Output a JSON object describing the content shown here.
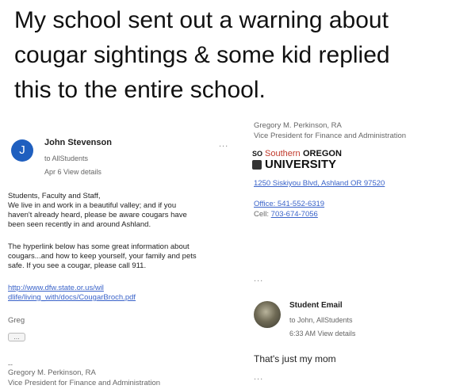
{
  "caption": {
    "line1": "My school sent out a warning about",
    "line2": "cougar sightings & some kid replied",
    "line3": "this to the entire school."
  },
  "left_email": {
    "avatar_letter": "J",
    "sender": "John Stevenson",
    "to": "to AllStudents",
    "date": "Apr 6",
    "view_details": "View details",
    "more": "...",
    "body_lines": [
      "Students, Faculty and Staff,",
      "We live in and work in a beautiful valley; and if you",
      "haven't already heard, please be aware cougars have",
      "been seen recently in and around Ashland."
    ],
    "body2_lines": [
      "The hyperlink below has some great information about",
      "cougars...and how to keep yourself, your family and pets",
      "safe.  If you see a cougar, please call 911."
    ],
    "link_line1": "http://www.dfw.state.or.us/wil",
    "link_line2": "dlife/living_with/docs/CougarBroch.pdf",
    "signoff": "Greg",
    "trimmed": "...",
    "sig_dashes": "--",
    "sig_name": "Gregory M. Perkinson, RA",
    "sig_title": "Vice President for Finance and Administration"
  },
  "right_signature": {
    "name": "Gregory M. Perkinson, RA",
    "title": "Vice President for Finance and Administration",
    "logo_badge": "SO",
    "logo_southern": "Southern",
    "logo_oregon": "OREGON",
    "logo_university": "UNIVERSITY",
    "address": "1250 Siskiyou Blvd, Ashland  OR 97520",
    "office": "Office: 541-552-6319",
    "cell_label": "Cell:",
    "cell_number": "703-674-7056",
    "more": "..."
  },
  "reply_email": {
    "sender": "Student Email",
    "to": "to John, AllStudents",
    "time": "6:33 AM",
    "view_details": "View details",
    "message": "That's just my mom",
    "more": "..."
  },
  "colors": {
    "link_blue": "#3a63c9",
    "avatar_blue": "#1f5fbf",
    "southern_red": "#c0392b"
  }
}
